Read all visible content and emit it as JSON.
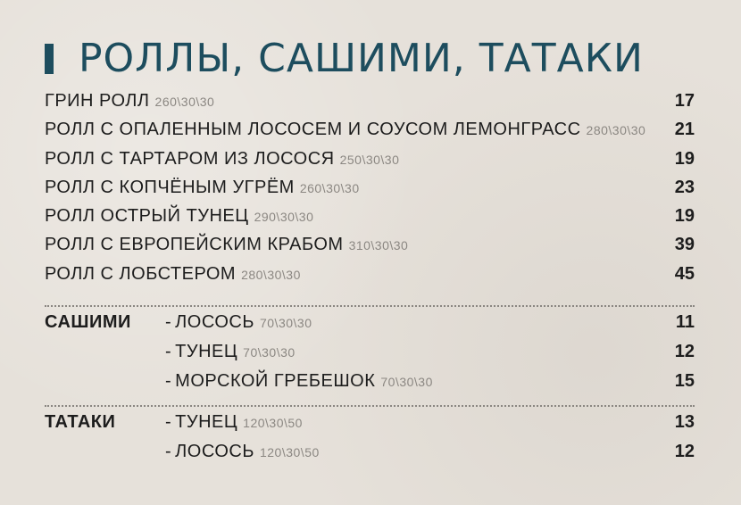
{
  "title": "РОЛЛЫ, САШИМИ, ТАТАКИ",
  "rolls": [
    {
      "name": "ГРИН РОЛЛ",
      "weight": "260\\30\\30",
      "price": "17"
    },
    {
      "name": "РОЛЛ С ОПАЛЕННЫМ ЛОСОСЕМ И СОУСОМ ЛЕМОНГРАСС",
      "weight": "280\\30\\30",
      "price": "21"
    },
    {
      "name": "РОЛЛ С ТАРТАРОМ ИЗ ЛОСОСЯ",
      "weight": "250\\30\\30",
      "price": "19"
    },
    {
      "name": "РОЛЛ С КОПЧЁНЫМ УГРЁМ",
      "weight": "260\\30\\30",
      "price": "23"
    },
    {
      "name": "РОЛЛ ОСТРЫЙ ТУНЕЦ",
      "weight": "290\\30\\30",
      "price": "19"
    },
    {
      "name": "РОЛЛ С ЕВРОПЕЙСКИМ КРАБОМ",
      "weight": "310\\30\\30",
      "price": "39"
    },
    {
      "name": "РОЛЛ С ЛОБСТЕРОМ",
      "weight": "280\\30\\30",
      "price": "45"
    }
  ],
  "sashimi": {
    "label": "САШИМИ",
    "items": [
      {
        "dash": "-",
        "name": "ЛОСОСЬ",
        "weight": "70\\30\\30",
        "price": "11"
      },
      {
        "dash": "-",
        "name": "ТУНЕЦ",
        "weight": "70\\30\\30",
        "price": "12"
      },
      {
        "dash": "-",
        "name": "МОРСКОЙ ГРЕБЕШОК",
        "weight": "70\\30\\30",
        "price": "15"
      }
    ]
  },
  "tataki": {
    "label": "ТАТАКИ",
    "items": [
      {
        "dash": "-",
        "name": "ТУНЕЦ",
        "weight": "120\\30\\50",
        "price": "13"
      },
      {
        "dash": "-",
        "name": "ЛОСОСЬ",
        "weight": "120\\30\\50",
        "price": "12"
      }
    ]
  }
}
